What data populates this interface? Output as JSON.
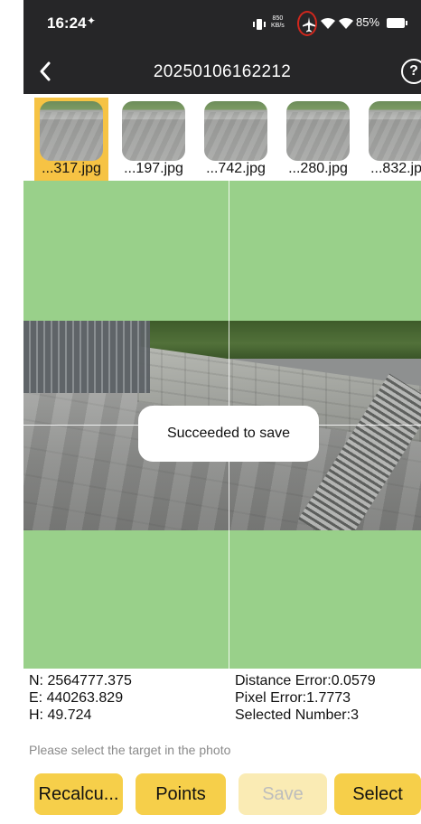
{
  "status_bar": {
    "time": "16:24",
    "net_speed_value": "850",
    "net_speed_unit": "KB/s",
    "battery": "85%",
    "icons": [
      "settings-icon",
      "vibrate-icon",
      "airplane-icon",
      "wifi-icon",
      "wifi-icon",
      "battery-icon"
    ]
  },
  "header": {
    "title": "20250106162212",
    "help": "?"
  },
  "thumbnails": [
    {
      "label": "...317.jpg",
      "selected": true
    },
    {
      "label": "...197.jpg",
      "selected": false
    },
    {
      "label": "...742.jpg",
      "selected": false
    },
    {
      "label": "...280.jpg",
      "selected": false
    },
    {
      "label": "...832.jpg",
      "selected": false
    }
  ],
  "toast": "Succeeded to save",
  "coordinates": {
    "n": "N: 2564777.375",
    "e": "E: 440263.829",
    "h": "H: 49.724"
  },
  "errors": {
    "distance": "Distance Error:0.0579",
    "pixel": "Pixel Error:1.7773",
    "selected": "Selected Number:3"
  },
  "hint": "Please select the target in the photo",
  "actions": {
    "recalculate": "Recalcu...",
    "points": "Points",
    "save": "Save",
    "select": "Select"
  },
  "colors": {
    "accent": "#f6cf4a",
    "viewer_bg": "#99d08a",
    "bar_bg": "#262628",
    "airplane_ring": "#d0271d"
  }
}
